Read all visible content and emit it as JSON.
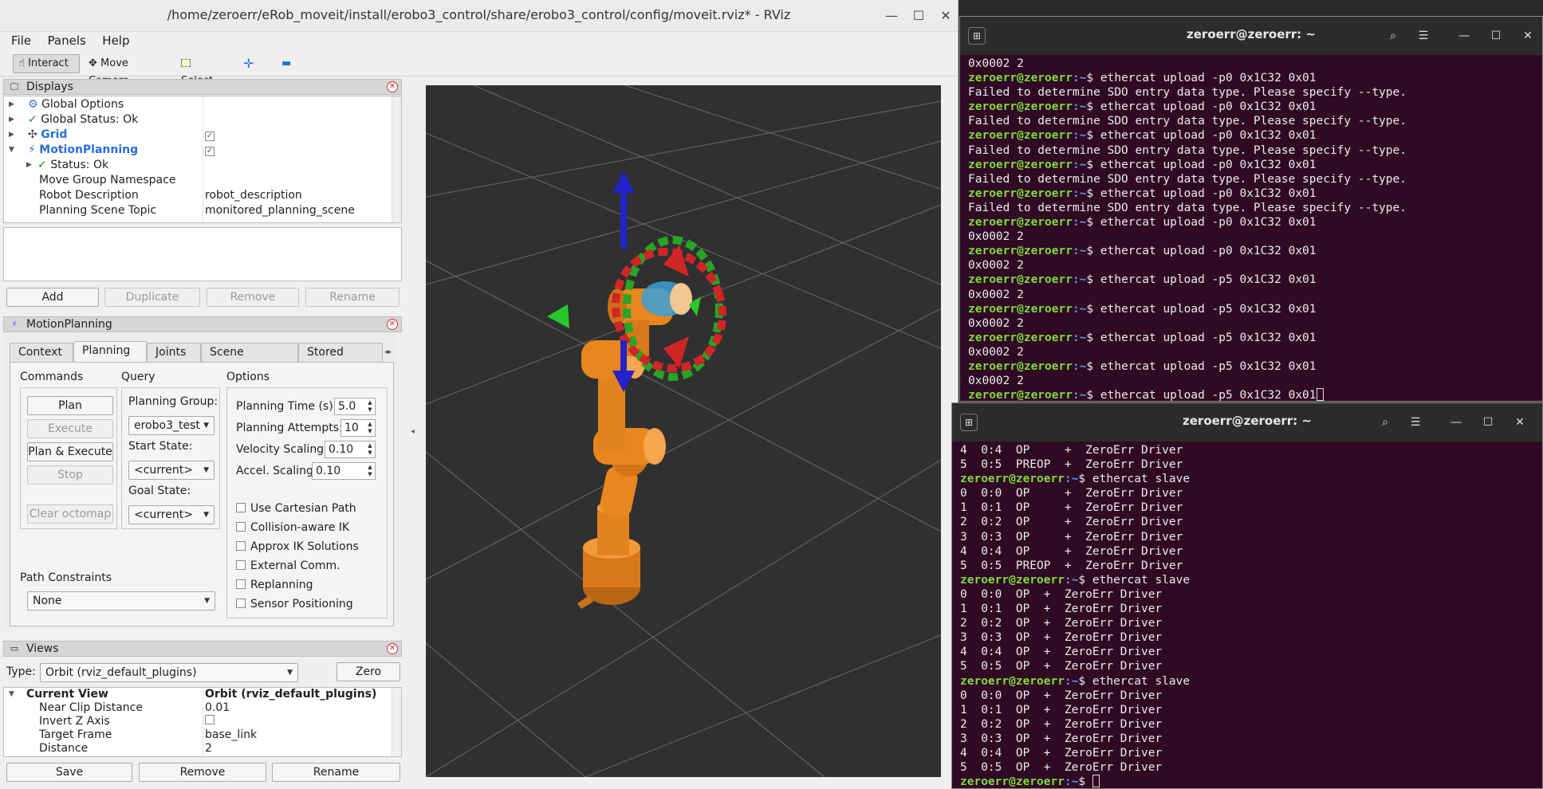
{
  "rviz": {
    "title": "/home/zeroerr/eRob_moveit/install/erobo3_control/share/erobo3_control/config/moveit.rviz* - RViz",
    "menu": [
      "File",
      "Panels",
      "Help"
    ],
    "toolbar": {
      "interact": "Interact",
      "move_camera": "Move Camera",
      "select": "Select"
    },
    "displays": {
      "title": "Displays",
      "rows": [
        {
          "label": "Global Options",
          "value": ""
        },
        {
          "label": "Global Status: Ok",
          "value": ""
        },
        {
          "label": "Grid",
          "value": ""
        },
        {
          "label": "MotionPlanning",
          "value": ""
        },
        {
          "label": "Status: Ok",
          "value": ""
        },
        {
          "label": "Move Group Namespace",
          "value": ""
        },
        {
          "label": "Robot Description",
          "value": "robot_description"
        },
        {
          "label": "Planning Scene Topic",
          "value": "monitored_planning_scene"
        }
      ],
      "buttons": [
        "Add",
        "Duplicate",
        "Remove",
        "Rename"
      ]
    },
    "motion_planning": {
      "title": "MotionPlanning",
      "tabs": [
        "Context",
        "Planning",
        "Joints",
        "Scene Objects",
        "Stored Scene"
      ],
      "commands_label": "Commands",
      "query_label": "Query",
      "options_label": "Options",
      "commands": [
        "Plan",
        "Execute",
        "Plan & Execute",
        "Stop",
        "Clear octomap"
      ],
      "planning_group_label": "Planning Group:",
      "planning_group": "erobo3_test",
      "start_state_label": "Start State:",
      "start_state": "<current>",
      "goal_state_label": "Goal State:",
      "goal_state": "<current>",
      "planning_time_label": "Planning Time (s):",
      "planning_time": "5.0",
      "planning_attempts_label": "Planning Attempts:",
      "planning_attempts": "10",
      "velocity_scaling_label": "Velocity Scaling:",
      "velocity_scaling": "0.10",
      "accel_scaling_label": "Accel. Scaling:",
      "accel_scaling": "0.10",
      "checkboxes": [
        "Use Cartesian Path",
        "Collision-aware IK",
        "Approx IK Solutions",
        "External Comm.",
        "Replanning",
        "Sensor Positioning"
      ],
      "path_constraints_label": "Path Constraints",
      "path_constraints": "None"
    },
    "views": {
      "title": "Views",
      "type_label": "Type:",
      "type": "Orbit (rviz_default_plugins)",
      "zero": "Zero",
      "current_view": "Current View",
      "current_view_value": "Orbit (rviz_default_plugins)",
      "rows": [
        {
          "label": "Near Clip Distance",
          "value": "0.01"
        },
        {
          "label": "Invert Z Axis",
          "value": ""
        },
        {
          "label": "Target Frame",
          "value": "base_link"
        },
        {
          "label": "Distance",
          "value": "2"
        }
      ],
      "buttons": [
        "Save",
        "Remove",
        "Rename"
      ]
    }
  },
  "terminal1": {
    "title": "zeroerr@zeroerr: ~",
    "prompt": "zeroerr@zeroerr",
    "path": ":~",
    "lines": [
      {
        "t": "out",
        "text": "0x0002 2"
      },
      {
        "t": "cmd",
        "text": "$ ethercat upload -p0 0x1C32 0x01"
      },
      {
        "t": "out",
        "text": "Failed to determine SDO entry data type. Please specify --type."
      },
      {
        "t": "cmd",
        "text": "$ ethercat upload -p0 0x1C32 0x01"
      },
      {
        "t": "out",
        "text": "Failed to determine SDO entry data type. Please specify --type."
      },
      {
        "t": "cmd",
        "text": "$ ethercat upload -p0 0x1C32 0x01"
      },
      {
        "t": "out",
        "text": "Failed to determine SDO entry data type. Please specify --type."
      },
      {
        "t": "cmd",
        "text": "$ ethercat upload -p0 0x1C32 0x01"
      },
      {
        "t": "out",
        "text": "Failed to determine SDO entry data type. Please specify --type."
      },
      {
        "t": "cmd",
        "text": "$ ethercat upload -p0 0x1C32 0x01"
      },
      {
        "t": "out",
        "text": "Failed to determine SDO entry data type. Please specify --type."
      },
      {
        "t": "cmd",
        "text": "$ ethercat upload -p0 0x1C32 0x01"
      },
      {
        "t": "out",
        "text": "0x0002 2"
      },
      {
        "t": "cmd",
        "text": "$ ethercat upload -p0 0x1C32 0x01"
      },
      {
        "t": "out",
        "text": "0x0002 2"
      },
      {
        "t": "cmd",
        "text": "$ ethercat upload -p5 0x1C32 0x01"
      },
      {
        "t": "out",
        "text": "0x0002 2"
      },
      {
        "t": "cmd",
        "text": "$ ethercat upload -p5 0x1C32 0x01"
      },
      {
        "t": "out",
        "text": "0x0002 2"
      },
      {
        "t": "cmd",
        "text": "$ ethercat upload -p5 0x1C32 0x01"
      },
      {
        "t": "out",
        "text": "0x0002 2"
      },
      {
        "t": "cmd",
        "text": "$ ethercat upload -p5 0x1C32 0x01"
      },
      {
        "t": "out",
        "text": "0x0002 2"
      },
      {
        "t": "cmd",
        "text": "$ ethercat upload -p5 0x1C32 0x01",
        "cursor": true
      }
    ]
  },
  "terminal2": {
    "title": "zeroerr@zeroerr: ~",
    "prompt": "zeroerr@zeroerr",
    "path": ":~",
    "lines": [
      {
        "t": "out",
        "text": "4  0:4  OP     +  ZeroErr Driver"
      },
      {
        "t": "out",
        "text": "5  0:5  PREOP  +  ZeroErr Driver"
      },
      {
        "t": "cmd",
        "text": "$ ethercat slave"
      },
      {
        "t": "out",
        "text": "0  0:0  OP     +  ZeroErr Driver"
      },
      {
        "t": "out",
        "text": "1  0:1  OP     +  ZeroErr Driver"
      },
      {
        "t": "out",
        "text": "2  0:2  OP     +  ZeroErr Driver"
      },
      {
        "t": "out",
        "text": "3  0:3  OP     +  ZeroErr Driver"
      },
      {
        "t": "out",
        "text": "4  0:4  OP     +  ZeroErr Driver"
      },
      {
        "t": "out",
        "text": "5  0:5  PREOP  +  ZeroErr Driver"
      },
      {
        "t": "cmd",
        "text": "$ ethercat slave"
      },
      {
        "t": "out",
        "text": "0  0:0  OP  +  ZeroErr Driver"
      },
      {
        "t": "out",
        "text": "1  0:1  OP  +  ZeroErr Driver"
      },
      {
        "t": "out",
        "text": "2  0:2  OP  +  ZeroErr Driver"
      },
      {
        "t": "out",
        "text": "3  0:3  OP  +  ZeroErr Driver"
      },
      {
        "t": "out",
        "text": "4  0:4  OP  +  ZeroErr Driver"
      },
      {
        "t": "out",
        "text": "5  0:5  OP  +  ZeroErr Driver"
      },
      {
        "t": "cmd",
        "text": "$ ethercat slave"
      },
      {
        "t": "out",
        "text": "0  0:0  OP  +  ZeroErr Driver"
      },
      {
        "t": "out",
        "text": "1  0:1  OP  +  ZeroErr Driver"
      },
      {
        "t": "out",
        "text": "2  0:2  OP  +  ZeroErr Driver"
      },
      {
        "t": "out",
        "text": "3  0:3  OP  +  ZeroErr Driver"
      },
      {
        "t": "out",
        "text": "4  0:4  OP  +  ZeroErr Driver"
      },
      {
        "t": "out",
        "text": "5  0:5  OP  +  ZeroErr Driver"
      },
      {
        "t": "cmd",
        "text": "$ ",
        "cursor": true
      }
    ]
  },
  "colors": {
    "terminal_bg": "#300a24",
    "prompt_user": "#7fdc3c",
    "prompt_path": "#5d9ee6",
    "robot": "#e8871e",
    "viewport_bg": "#303030"
  }
}
